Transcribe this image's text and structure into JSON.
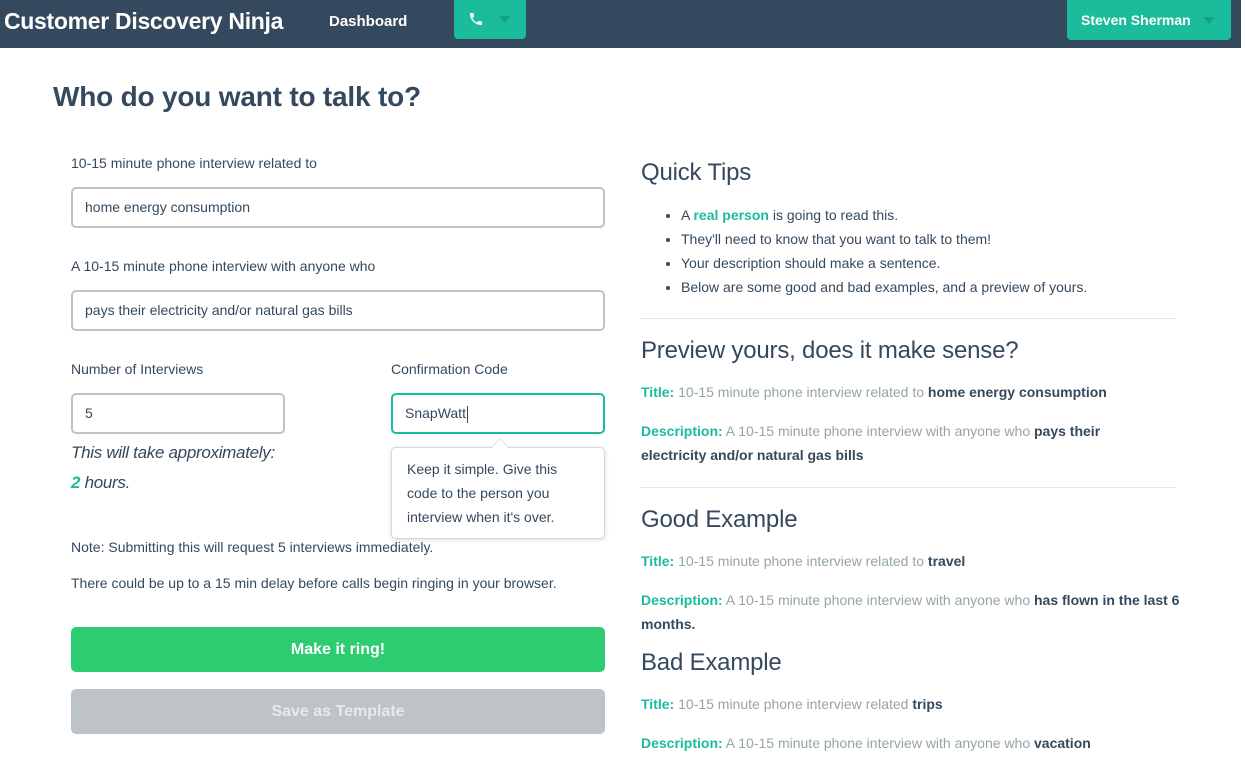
{
  "nav": {
    "brand": "Customer Discovery Ninja",
    "dashboard": "Dashboard",
    "user_name": "Steven Sherman"
  },
  "page_title": "Who do you want to talk to?",
  "form": {
    "topic_label": "10-15 minute phone interview related to",
    "topic_value": "home energy consumption",
    "audience_label": "A 10-15 minute phone interview with anyone who",
    "audience_value": "pays their electricity and/or natural gas bills",
    "interviews_label": "Number of Interviews",
    "interviews_value": "5",
    "code_label": "Confirmation Code",
    "code_value": "SnapWatt",
    "estimate_prefix": "This will take approximately:",
    "estimate_hours": "2",
    "estimate_suffix": " hours.",
    "popover_text": "Keep it simple. Give this code to the person you interview when it's over.",
    "note_1": "Note: Submitting this will request 5 interviews immediately.",
    "note_2": "There could be up to a 15 min delay before calls begin ringing in your browser.",
    "submit_label": "Make it ring!",
    "template_label": "Save as Template"
  },
  "tips": {
    "title": "Quick Tips",
    "item1_pre": "A ",
    "item1_hl": "real person",
    "item1_post": " is going to read this.",
    "item2": "They'll need to know that you want to talk to them!",
    "item3": "Your description should make a sentence.",
    "item4": "Below are some good and bad examples, and a preview of yours."
  },
  "preview": {
    "title": "Preview yours, does it make sense?",
    "title_key": "Title:",
    "title_text": " 10-15 minute phone interview related to ",
    "title_value": "home energy consumption",
    "desc_key": "Description:",
    "desc_text": " A 10-15 minute phone interview with anyone who ",
    "desc_value": "pays their electricity and/or natural gas bills"
  },
  "good": {
    "title": "Good Example",
    "title_key": "Title:",
    "title_text": " 10-15 minute phone interview related to ",
    "title_value": "travel",
    "desc_key": "Description:",
    "desc_text": " A 10-15 minute phone interview with anyone who ",
    "desc_value": "has flown in the last 6 months."
  },
  "bad": {
    "title": "Bad Example",
    "title_key": "Title:",
    "title_text": " 10-15 minute phone interview related ",
    "title_value": "trips",
    "desc_key": "Description:",
    "desc_text": " A 10-15 minute phone interview with anyone who ",
    "desc_value": "vacation"
  },
  "icons": {
    "phone": "phone-icon",
    "dropdown": "chevron-down-icon"
  },
  "colors": {
    "navbar": "#34495e",
    "accent": "#1abc9c",
    "primary_button": "#2ecc71",
    "disabled_button": "#bdc3c7"
  }
}
